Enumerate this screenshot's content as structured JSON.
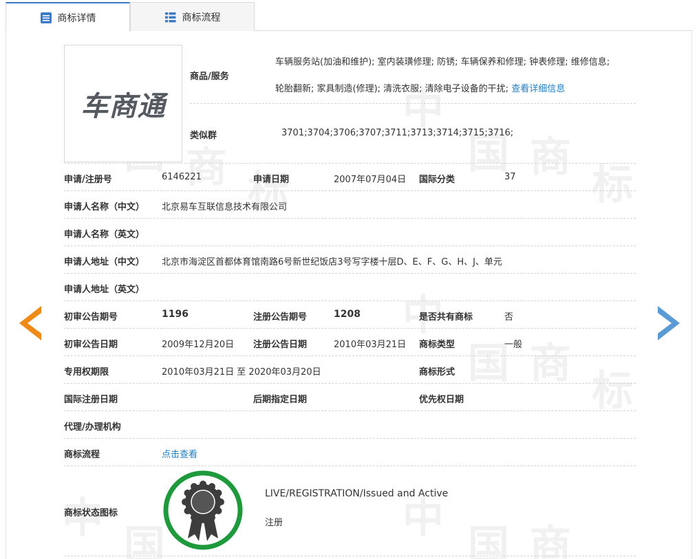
{
  "tabs": [
    {
      "label": "商标详情",
      "active": true,
      "icon": "list-doc-icon"
    },
    {
      "label": "商标流程",
      "active": false,
      "icon": "list-icon"
    }
  ],
  "logo": {
    "text": "车商通"
  },
  "watermark": {
    "chars": [
      "中",
      "国",
      "商",
      "标"
    ]
  },
  "goods": {
    "label": "商品/服务",
    "line1": "车辆服务站(加油和维护); 室内装璜修理; 防锈; 车辆保养和修理; 钟表修理; 维修信息;",
    "line2": "轮胎翻新; 家具制造(修理); 清洗衣服; 清除电子设备的干扰;",
    "more_link": "查看详细信息"
  },
  "similar_group": {
    "label": "类似群",
    "value": "3701;3704;3706;3707;3711;3713;3714;3715;3716;"
  },
  "rows": {
    "reg_no": {
      "label": "申请/注册号",
      "value": "6146221"
    },
    "apply_date": {
      "label": "申请日期",
      "value": "2007年07月04日"
    },
    "intl_class": {
      "label": "国际分类",
      "value": "37"
    },
    "applicant_cn": {
      "label": "申请人名称（中文）",
      "value": "北京易车互联信息技术有限公司"
    },
    "applicant_en": {
      "label": "申请人名称（英文）",
      "value": ""
    },
    "address_cn": {
      "label": "申请人地址（中文）",
      "value": "北京市海淀区首都体育馆南路6号新世纪饭店3号写字楼十层D、E、F、G、H、J、单元"
    },
    "address_en": {
      "label": "申请人地址（英文）",
      "value": ""
    },
    "prelim_issue": {
      "label": "初审公告期号",
      "value": "1196"
    },
    "reg_issue": {
      "label": "注册公告期号",
      "value": "1208"
    },
    "shared_mark": {
      "label": "是否共有商标",
      "value": "否"
    },
    "prelim_date": {
      "label": "初审公告日期",
      "value": "2009年12月20日"
    },
    "reg_date": {
      "label": "注册公告日期",
      "value": "2010年03月21日"
    },
    "mark_type": {
      "label": "商标类型",
      "value": "一般"
    },
    "exclusive_period": {
      "label": "专用权期限",
      "value": "2010年03月21日 至 2020年03月20日"
    },
    "mark_form": {
      "label": "商标形式",
      "value": ""
    },
    "intl_reg_date": {
      "label": "国际注册日期",
      "value": ""
    },
    "later_designation": {
      "label": "后期指定日期",
      "value": ""
    },
    "priority_date": {
      "label": "优先权日期",
      "value": ""
    },
    "agency": {
      "label": "代理/办理机构",
      "value": ""
    },
    "process": {
      "label": "商标流程",
      "value": "点击查看"
    },
    "status_icon": {
      "label": "商标状态图标"
    }
  },
  "status": {
    "english": "LIVE/REGISTRATION/Issued and Active",
    "chinese": "注册",
    "ring_color": "#1e9a3c",
    "medal_color": "#3d3d3d"
  },
  "nav": {
    "prev_color": "#f08a17",
    "next_color": "#5b9bd5"
  }
}
